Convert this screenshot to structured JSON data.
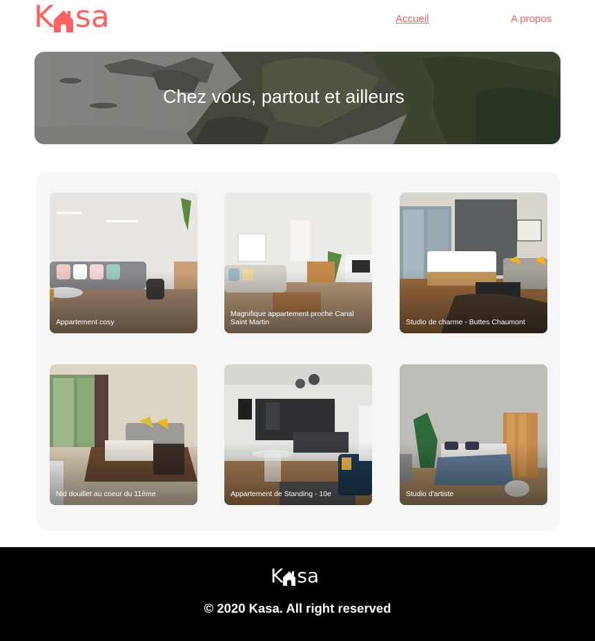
{
  "brand": {
    "logo_k": "K",
    "logo_rest": "sa",
    "accent": "#FF6060"
  },
  "nav": {
    "home_label": "Accueil",
    "about_label": "A propos"
  },
  "banner": {
    "title": "Chez vous, partout et ailleurs"
  },
  "listings": [
    {
      "title": "Appartement cosy"
    },
    {
      "title": "Magnifique appartement proche Canal Saint Martin"
    },
    {
      "title": "Studio de charme - Buttes Chaumont"
    },
    {
      "title": "Nid douillet au coeur du 11ème"
    },
    {
      "title": "Appartement de Standing - 10e"
    },
    {
      "title": "Studio d'artiste"
    }
  ],
  "footer": {
    "logo_k": "K",
    "logo_rest": "sa",
    "copyright": "© 2020 Kasa. All right reserved"
  }
}
